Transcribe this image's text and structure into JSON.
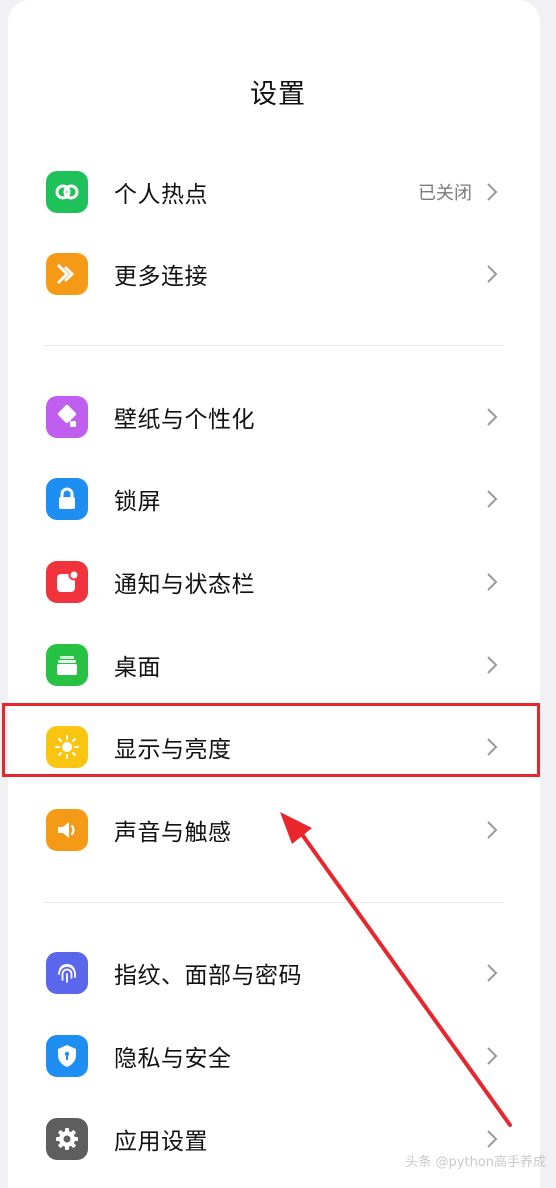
{
  "page": {
    "title": "设置"
  },
  "groups": [
    {
      "items": [
        {
          "label": "个人热点",
          "value": "已关闭",
          "icon": "hotspot-icon",
          "color": "#1fc15a"
        },
        {
          "label": "更多连接",
          "value": "",
          "icon": "more-connections-icon",
          "color": "#f59a16"
        }
      ]
    },
    {
      "items": [
        {
          "label": "壁纸与个性化",
          "value": "",
          "icon": "wallpaper-icon",
          "color": "#c05ef0"
        },
        {
          "label": "锁屏",
          "value": "",
          "icon": "lock-icon",
          "color": "#1f8ef2"
        },
        {
          "label": "通知与状态栏",
          "value": "",
          "icon": "notification-icon",
          "color": "#f0333c"
        },
        {
          "label": "桌面",
          "value": "",
          "icon": "desktop-icon",
          "color": "#27c244"
        },
        {
          "label": "显示与亮度",
          "value": "",
          "icon": "brightness-icon",
          "color": "#f9c511"
        },
        {
          "label": "声音与触感",
          "value": "",
          "icon": "sound-icon",
          "color": "#f59a16"
        }
      ]
    },
    {
      "items": [
        {
          "label": "指纹、面部与密码",
          "value": "",
          "icon": "fingerprint-icon",
          "color": "#5a67ec"
        },
        {
          "label": "隐私与安全",
          "value": "",
          "icon": "privacy-shield-icon",
          "color": "#1f8ef2"
        },
        {
          "label": "应用设置",
          "value": "",
          "icon": "gear-icon",
          "color": "#5e5e5e"
        }
      ]
    }
  ],
  "annotation": {
    "highlighted_item": "显示与亮度",
    "box_color": "#e8262b"
  },
  "watermark": "头条 @python高手养成"
}
